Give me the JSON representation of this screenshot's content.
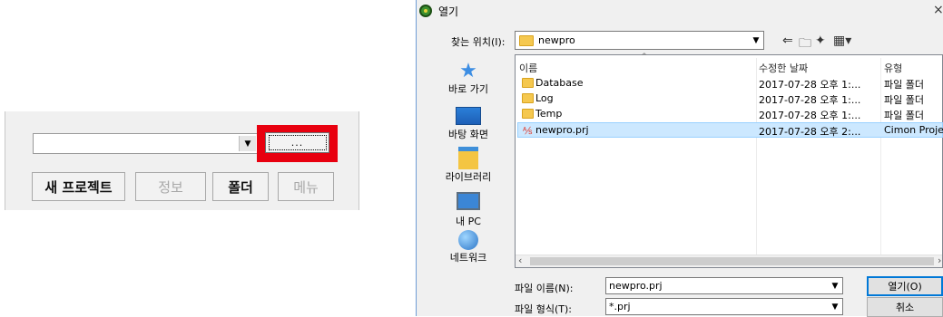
{
  "left_panel": {
    "combo_value": "",
    "browse_label": "...",
    "buttons": [
      "새 프로젝트",
      "정보",
      "폴더",
      "메뉴"
    ]
  },
  "dialog": {
    "title": "열기",
    "close_label": "×",
    "look_in_label": "찾는 위치(I):",
    "look_in_value": "newpro",
    "places": [
      "바로 가기",
      "바탕 화면",
      "라이브러리",
      "내 PC",
      "네트워크"
    ],
    "columns": [
      "이름",
      "수정한 날짜",
      "유형"
    ],
    "files": [
      {
        "name": "Database",
        "date": "2017-07-28 오후 1:...",
        "type": "파일 폴더",
        "kind": "folder"
      },
      {
        "name": "Log",
        "date": "2017-07-28 오후 1:...",
        "type": "파일 폴더",
        "kind": "folder"
      },
      {
        "name": "Temp",
        "date": "2017-07-28 오후 1:...",
        "type": "파일 폴더",
        "kind": "folder"
      },
      {
        "name": "newpro.prj",
        "date": "2017-07-28 오후 2:...",
        "type": "Cimon Projec",
        "kind": "project"
      }
    ],
    "file_name_label": "파일 이름(N):",
    "file_name_value": "newpro.prj",
    "file_type_label": "파일 형식(T):",
    "file_type_value": "*.prj",
    "open_label": "열기(O)",
    "cancel_label": "취소"
  }
}
